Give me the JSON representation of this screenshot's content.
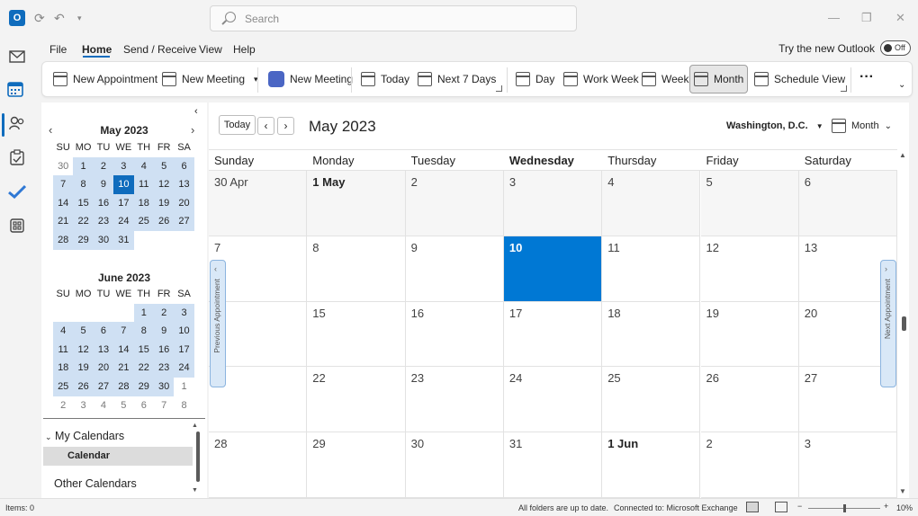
{
  "titlebar": {
    "search_placeholder": "Search",
    "minimize": "—",
    "restore": "❐",
    "close": "✕"
  },
  "menu": {
    "file": "File",
    "home": "Home",
    "send_receive": "Send / Receive",
    "view": "View",
    "help": "Help",
    "try_new": "Try the new Outlook",
    "toggle_label": "Off"
  },
  "ribbon": {
    "new_appointment": "New Appointment",
    "new_meeting": "New Meeting",
    "teams_meeting": "New Meeting",
    "today": "Today",
    "next7": "Next 7 Days",
    "day": "Day",
    "work_week": "Work Week",
    "week": "Week",
    "month": "Month",
    "schedule_view": "Schedule View",
    "more": "···",
    "selected_view": "Month"
  },
  "mini_calendars": [
    {
      "title": "May 2023",
      "dow": [
        "SU",
        "MO",
        "TU",
        "WE",
        "TH",
        "FR",
        "SA"
      ],
      "weeks": [
        [
          "30",
          "1",
          "2",
          "3",
          "4",
          "5",
          "6"
        ],
        [
          "7",
          "8",
          "9",
          "10",
          "11",
          "12",
          "13"
        ],
        [
          "14",
          "15",
          "16",
          "17",
          "18",
          "19",
          "20"
        ],
        [
          "21",
          "22",
          "23",
          "24",
          "25",
          "26",
          "27"
        ],
        [
          "28",
          "29",
          "30",
          "31",
          "",
          "",
          ""
        ]
      ]
    },
    {
      "title": "June 2023",
      "dow": [
        "SU",
        "MO",
        "TU",
        "WE",
        "TH",
        "FR",
        "SA"
      ],
      "weeks": [
        [
          "",
          "",
          "",
          "",
          "1",
          "2",
          "3"
        ],
        [
          "4",
          "5",
          "6",
          "7",
          "8",
          "9",
          "10"
        ],
        [
          "11",
          "12",
          "13",
          "14",
          "15",
          "16",
          "17"
        ],
        [
          "18",
          "19",
          "20",
          "21",
          "22",
          "23",
          "24"
        ],
        [
          "25",
          "26",
          "27",
          "28",
          "29",
          "30",
          "1"
        ],
        [
          "2",
          "3",
          "4",
          "5",
          "6",
          "7",
          "8"
        ]
      ]
    }
  ],
  "nav": {
    "my_calendars": "My Calendars",
    "calendar": "Calendar",
    "other_calendars": "Other Calendars"
  },
  "calendar": {
    "today_btn": "Today",
    "prev": "‹",
    "next": "›",
    "title": "May 2023",
    "location": "Washington,  D.C.",
    "view": "Month",
    "dow": [
      "Sunday",
      "Monday",
      "Tuesday",
      "Wednesday",
      "Thursday",
      "Friday",
      "Saturday"
    ],
    "weeks": [
      [
        "30 Apr",
        "1 May",
        "2",
        "3",
        "4",
        "5",
        "6"
      ],
      [
        "7",
        "8",
        "9",
        "10",
        "11",
        "12",
        "13"
      ],
      [
        "",
        "15",
        "16",
        "17",
        "18",
        "19",
        "20"
      ],
      [
        "",
        "22",
        "23",
        "24",
        "25",
        "26",
        "27"
      ],
      [
        "28",
        "29",
        "30",
        "31",
        "1 Jun",
        "2",
        "3"
      ]
    ],
    "prev_appointment": "Previous Appointment",
    "next_appointment": "Next Appointment"
  },
  "status": {
    "items": "Items: 0",
    "sync": "All folders are up to date.",
    "connection": "Connected to: Microsoft Exchange",
    "zoom": "10%"
  },
  "colors": {
    "accent": "#0f6cbd",
    "today_cell": "#0078d4",
    "mini_month_bg": "#cfe0f3"
  }
}
